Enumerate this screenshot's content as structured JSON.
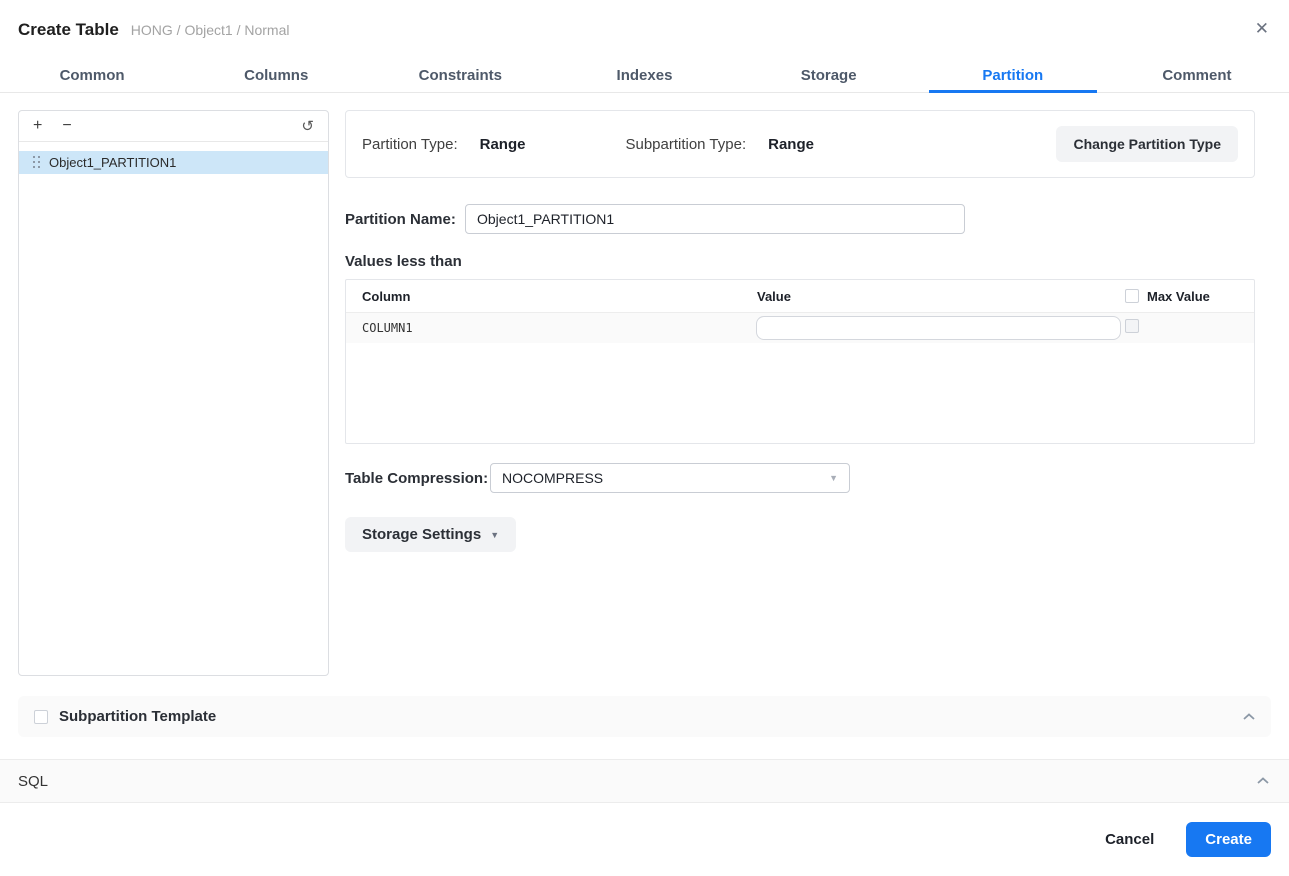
{
  "dialog": {
    "title": "Create Table",
    "breadcrumb": "HONG / Object1 / Normal",
    "close_icon": "✕"
  },
  "tabs": [
    {
      "label": "Common",
      "active": false
    },
    {
      "label": "Columns",
      "active": false
    },
    {
      "label": "Constraints",
      "active": false
    },
    {
      "label": "Indexes",
      "active": false
    },
    {
      "label": "Storage",
      "active": false
    },
    {
      "label": "Partition",
      "active": true
    },
    {
      "label": "Comment",
      "active": false
    }
  ],
  "partition_list": {
    "add_label": "+",
    "remove_label": "−",
    "refresh_icon": "↺",
    "items": [
      {
        "name": "Object1_PARTITION1",
        "selected": true
      }
    ]
  },
  "partition_info": {
    "partition_type_label": "Partition Type:",
    "partition_type_value": "Range",
    "subpartition_type_label": "Subpartition Type:",
    "subpartition_type_value": "Range",
    "change_button_label": "Change Partition Type"
  },
  "form": {
    "partition_name_label": "Partition Name:",
    "partition_name_value": "Object1_PARTITION1",
    "values_less_than_label": "Values less than",
    "table": {
      "headers": {
        "column": "Column",
        "value": "Value",
        "max_value": "Max Value"
      },
      "rows": [
        {
          "column": "COLUMN1",
          "value": "",
          "max_value_checked": false
        }
      ]
    },
    "table_compression_label": "Table Compression:",
    "table_compression_value": "NOCOMPRESS",
    "storage_settings_label": "Storage Settings"
  },
  "sections": {
    "subpartition_template": {
      "label": "Subpartition Template",
      "checked": false
    },
    "sql": {
      "label": "SQL"
    }
  },
  "footer": {
    "cancel_label": "Cancel",
    "create_label": "Create"
  },
  "colors": {
    "accent": "#1778f2",
    "selected_item_bg": "#cde6f8",
    "section_bar_bg": "#fafafa"
  }
}
